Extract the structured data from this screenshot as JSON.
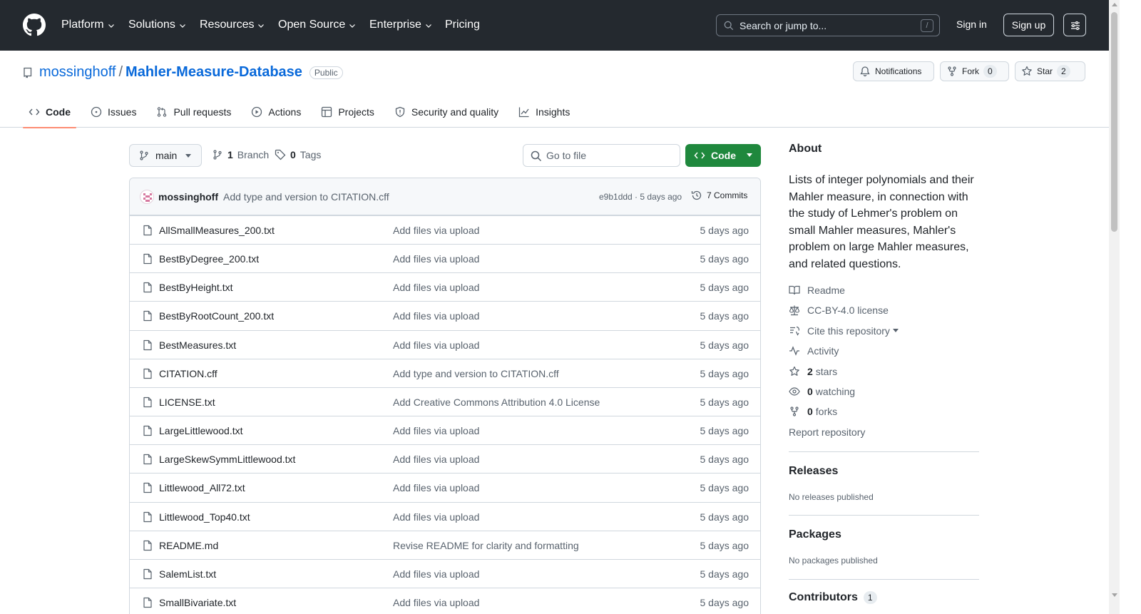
{
  "topnav": {
    "items": [
      "Platform",
      "Solutions",
      "Resources",
      "Open Source",
      "Enterprise",
      "Pricing"
    ],
    "search_placeholder": "Search or jump to...",
    "search_shortcut": "/",
    "sign_in": "Sign in",
    "sign_up": "Sign up"
  },
  "repo": {
    "owner": "mossinghoff",
    "separator": "/",
    "name": "Mahler-Measure-Database",
    "visibility": "Public",
    "notifications_label": "Notifications",
    "fork_label": "Fork",
    "fork_count": "0",
    "star_label": "Star",
    "star_count": "2"
  },
  "tabs": [
    "Code",
    "Issues",
    "Pull requests",
    "Actions",
    "Projects",
    "Security and quality",
    "Insights"
  ],
  "toolbar": {
    "branch": "main",
    "branch_count": "1",
    "branch_label": "Branch",
    "tag_count": "0",
    "tag_label": "Tags",
    "goto_placeholder": "Go to file",
    "code_label": "Code"
  },
  "latest_commit": {
    "author": "mossinghoff",
    "message": "Add type and version to CITATION.cff",
    "hash_time": "e9b1ddd · 5 days ago",
    "commits_label": "7 Commits"
  },
  "files": [
    {
      "name": "AllSmallMeasures_200.txt",
      "message": "Add files via upload",
      "date": "5 days ago"
    },
    {
      "name": "BestByDegree_200.txt",
      "message": "Add files via upload",
      "date": "5 days ago"
    },
    {
      "name": "BestByHeight.txt",
      "message": "Add files via upload",
      "date": "5 days ago"
    },
    {
      "name": "BestByRootCount_200.txt",
      "message": "Add files via upload",
      "date": "5 days ago"
    },
    {
      "name": "BestMeasures.txt",
      "message": "Add files via upload",
      "date": "5 days ago"
    },
    {
      "name": "CITATION.cff",
      "message": "Add type and version to CITATION.cff",
      "date": "5 days ago"
    },
    {
      "name": "LICENSE.txt",
      "message": "Add Creative Commons Attribution 4.0 License",
      "date": "5 days ago"
    },
    {
      "name": "LargeLittlewood.txt",
      "message": "Add files via upload",
      "date": "5 days ago"
    },
    {
      "name": "LargeSkewSymmLittlewood.txt",
      "message": "Add files via upload",
      "date": "5 days ago"
    },
    {
      "name": "Littlewood_All72.txt",
      "message": "Add files via upload",
      "date": "5 days ago"
    },
    {
      "name": "Littlewood_Top40.txt",
      "message": "Add files via upload",
      "date": "5 days ago"
    },
    {
      "name": "README.md",
      "message": "Revise README for clarity and formatting",
      "date": "5 days ago"
    },
    {
      "name": "SalemList.txt",
      "message": "Add files via upload",
      "date": "5 days ago"
    },
    {
      "name": "SmallBivariate.txt",
      "message": "Add files via upload",
      "date": "5 days ago"
    }
  ],
  "about": {
    "heading": "About",
    "description": "Lists of integer polynomials and their Mahler measure, in connection with the study of Lehmer's problem on small Mahler measures, Mahler's problem on large Mahler measures, and related questions.",
    "readme": "Readme",
    "license": "CC-BY-4.0 license",
    "cite": "Cite this repository",
    "activity": "Activity",
    "stars_count": "2",
    "stars_label": "stars",
    "watching_count": "0",
    "watching_label": "watching",
    "forks_count": "0",
    "forks_label": "forks",
    "report": "Report repository"
  },
  "releases": {
    "heading": "Releases",
    "empty": "No releases published"
  },
  "packages": {
    "heading": "Packages",
    "empty": "No packages published"
  },
  "contributors": {
    "heading": "Contributors",
    "count": "1"
  },
  "colors": {
    "header_bg": "#24292f",
    "link": "#0969da",
    "code_button": "#1f883d",
    "active_tab_underline": "#fd8c73"
  }
}
